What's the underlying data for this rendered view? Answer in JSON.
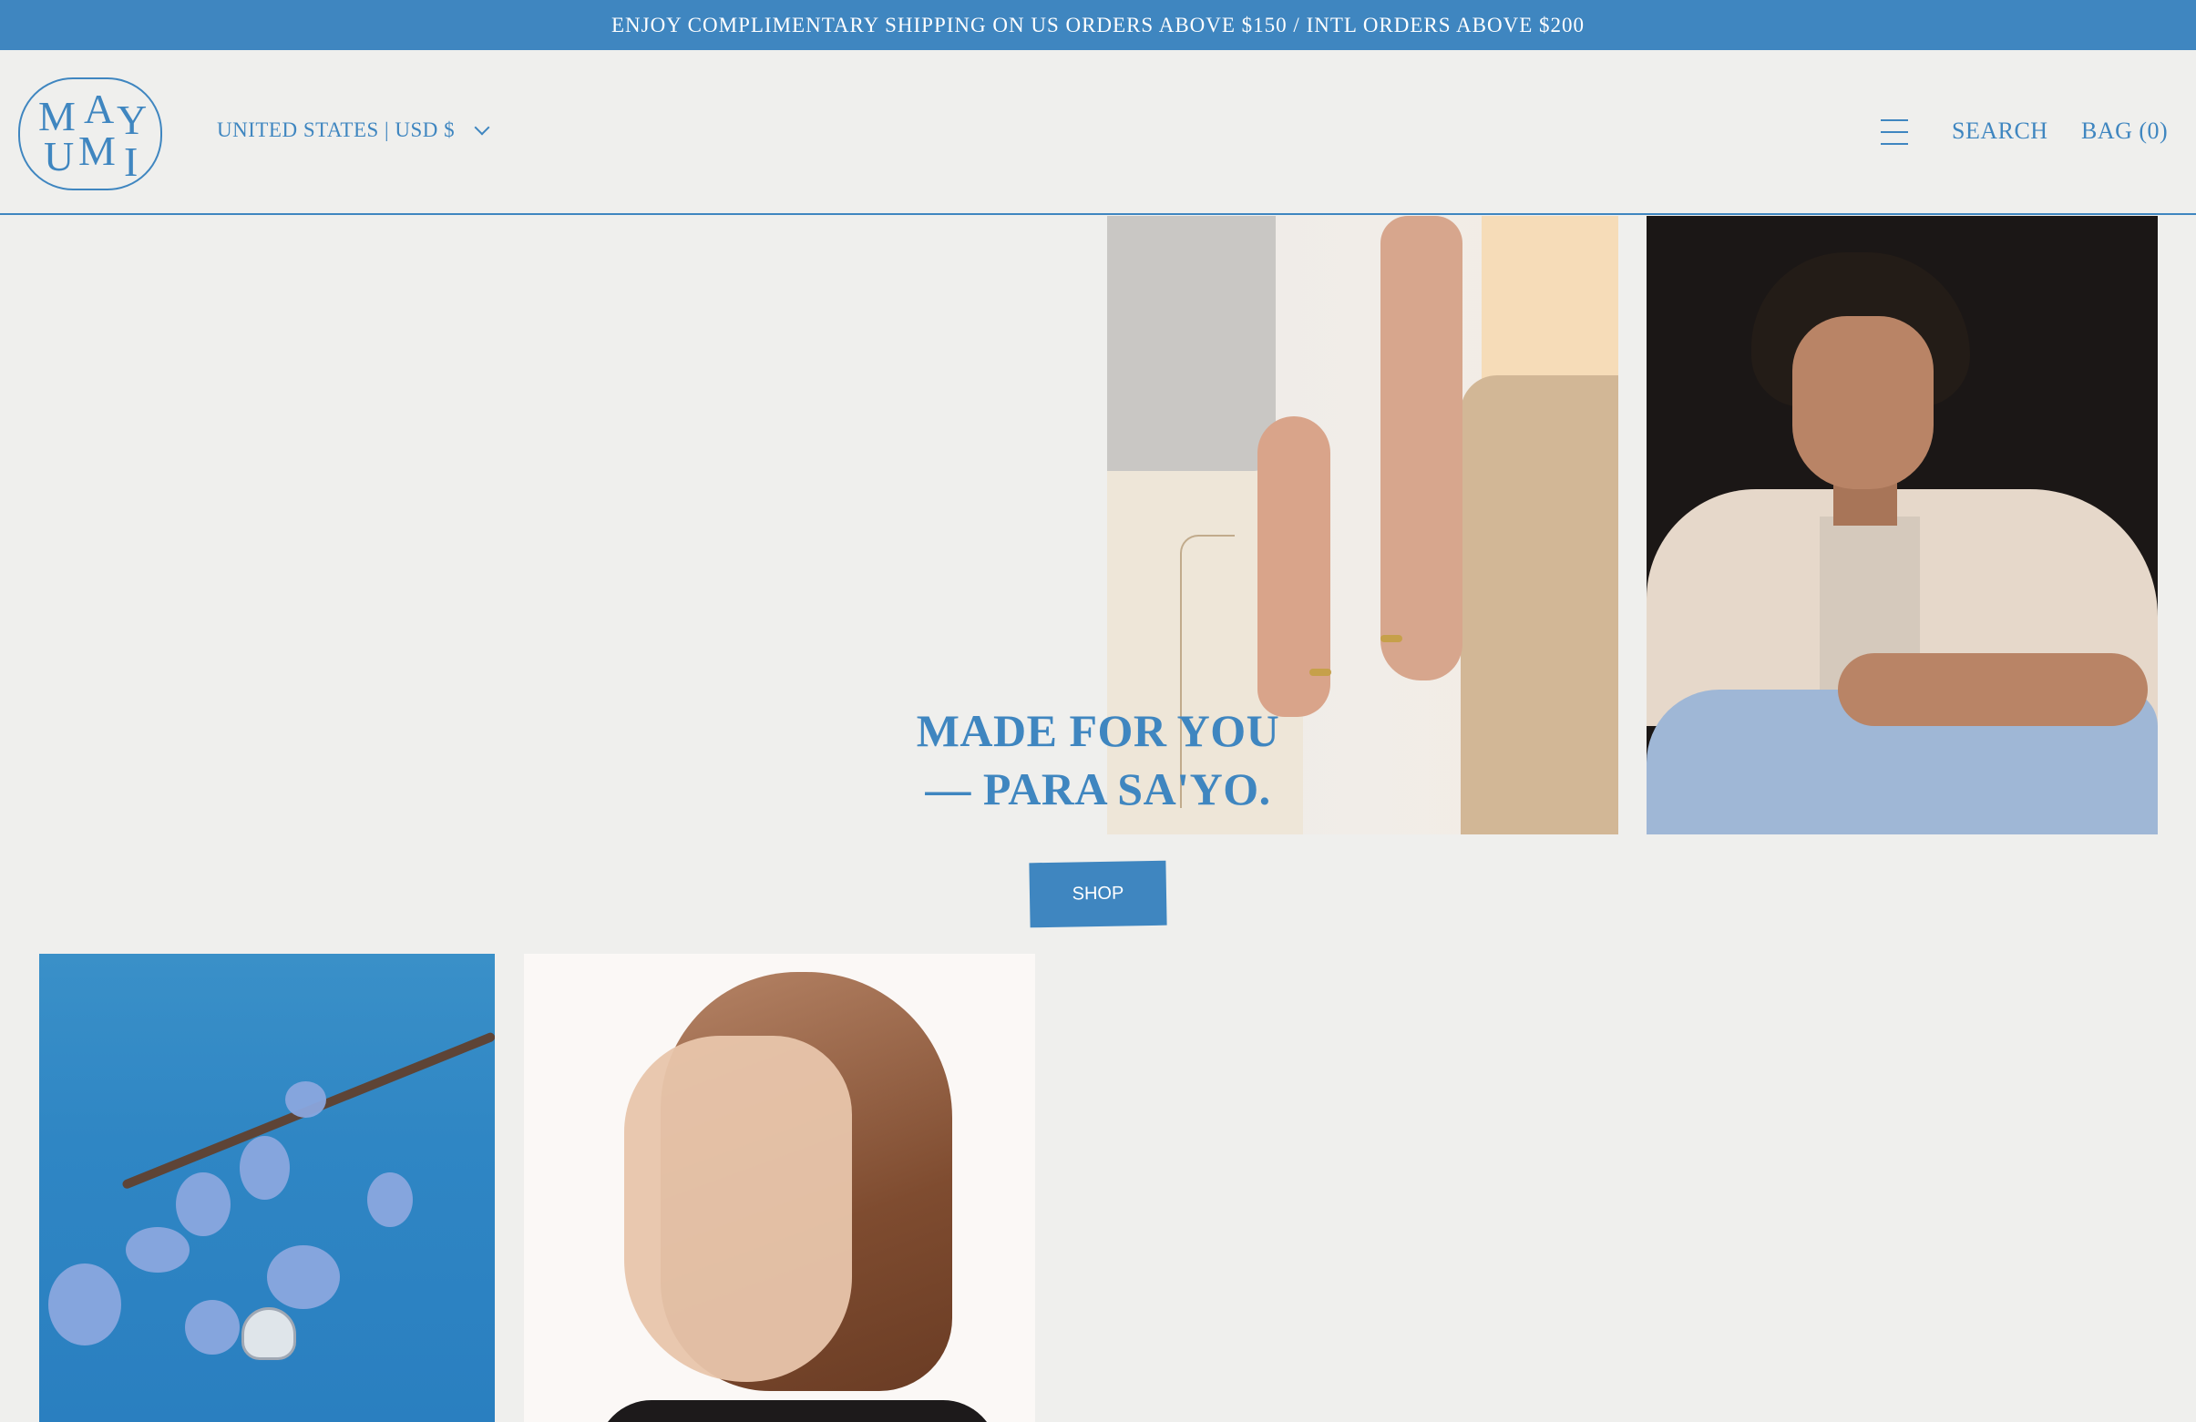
{
  "announcement": {
    "text": "ENJOY COMPLIMENTARY SHIPPING ON US ORDERS ABOVE $150 / INTL ORDERS ABOVE $200"
  },
  "header": {
    "logo_letters": [
      "M",
      "A",
      "Y",
      "U",
      "M",
      "I"
    ],
    "locale_label": "UNITED STATES | USD $",
    "menu_icon": "hamburger-menu-icon",
    "search_label": "SEARCH",
    "bag_label": "BAG (0)"
  },
  "hero": {
    "headline_line1": "MADE FOR YOU",
    "headline_line2": "— PARA SA'YO.",
    "shop_label": "SHOP"
  },
  "colors": {
    "accent": "#3f86c0",
    "background": "#efefed"
  }
}
